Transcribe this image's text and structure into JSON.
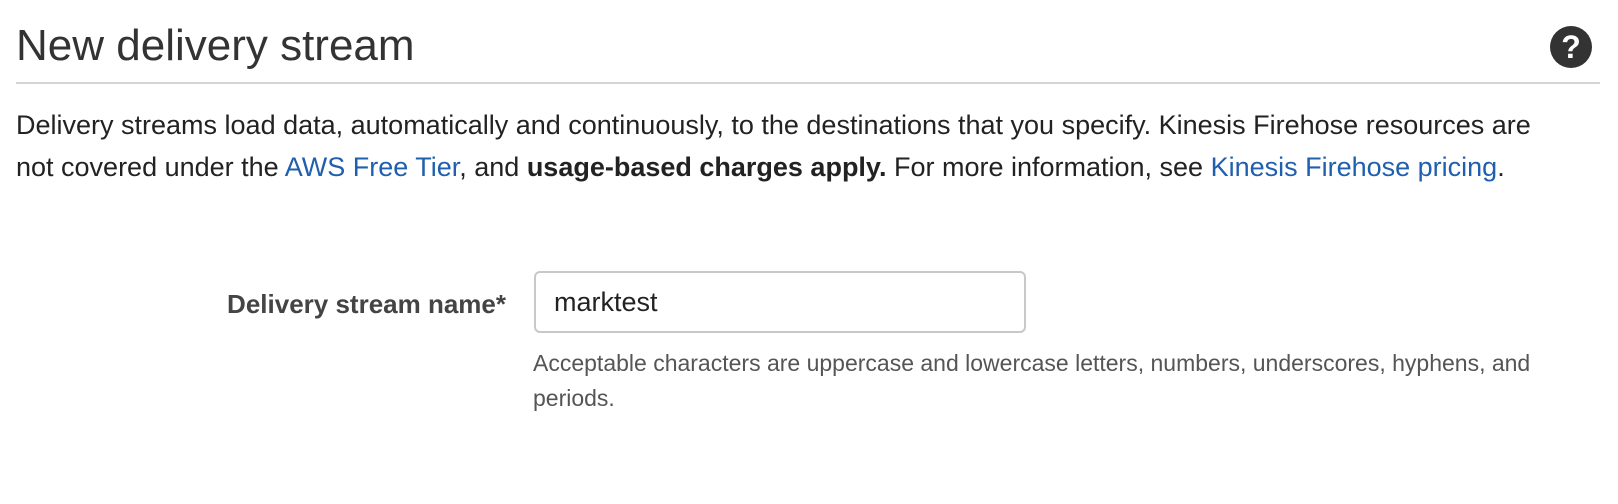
{
  "header": {
    "title": "New delivery stream",
    "help_icon": "question-circle-icon"
  },
  "description": {
    "text_1": "Delivery streams load data, automatically and continuously, to the destinations that you specify. Kinesis Firehose resources are not covered under the ",
    "link_free_tier": "AWS Free Tier",
    "text_2": ", and ",
    "bold_charges": "usage-based charges apply.",
    "text_3": " For more information, see ",
    "link_pricing": "Kinesis Firehose pricing",
    "text_4": "."
  },
  "form": {
    "name_label": "Delivery stream name*",
    "name_value": "marktest",
    "name_hint": "Acceptable characters are uppercase and lowercase letters, numbers, underscores, hyphens, and periods."
  },
  "colors": {
    "link": "#1f5fae",
    "title": "#333333",
    "divider": "#d5d5d5"
  }
}
